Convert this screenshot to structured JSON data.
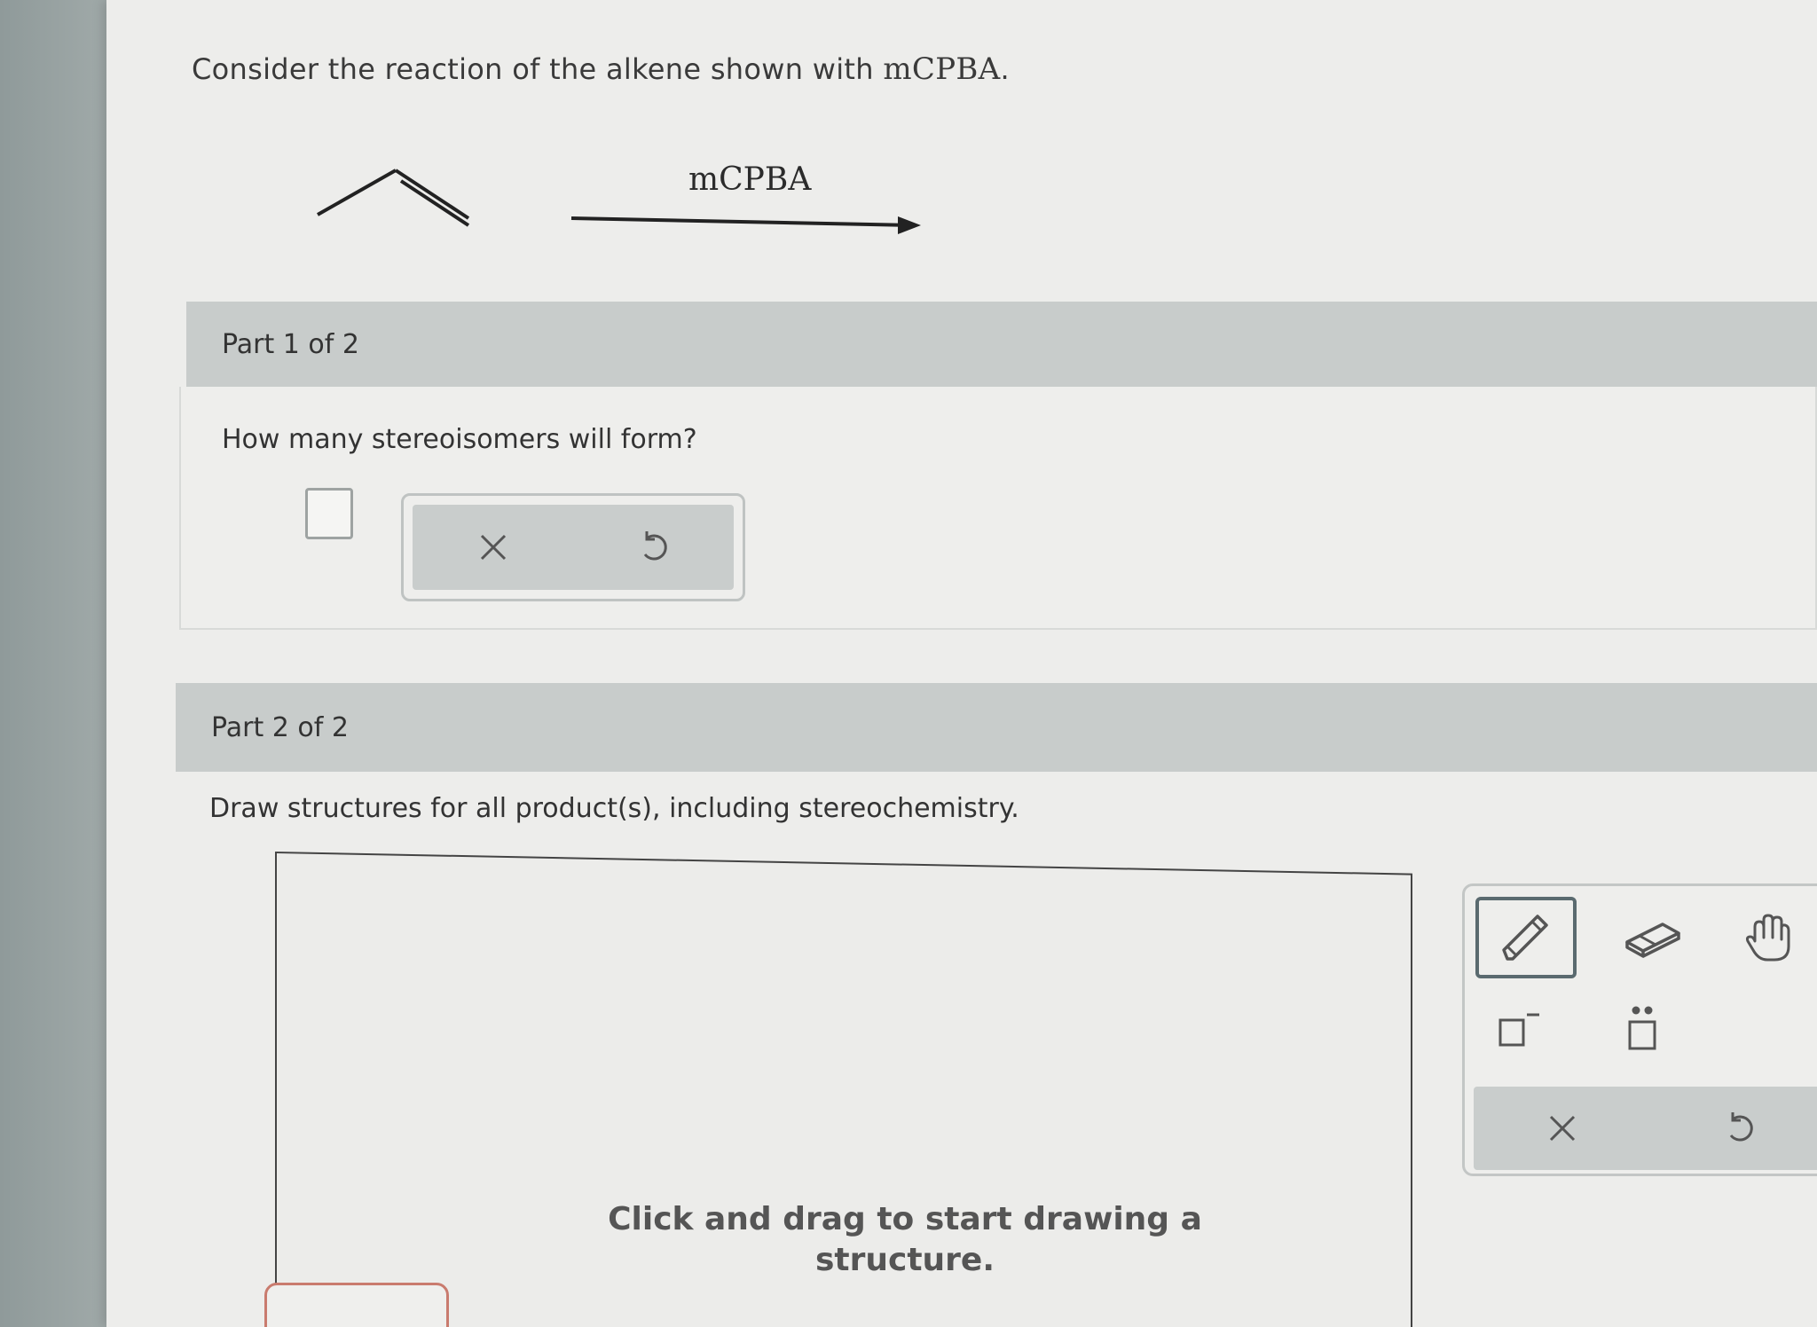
{
  "question": {
    "prefix": "Consider the reaction of the alkene shown with ",
    "reagent_inline": "mCPBA",
    "suffix": "."
  },
  "reaction": {
    "reagent_label": "mCPBA",
    "reactant": "propene (skeletal structure)"
  },
  "part1": {
    "header": "Part 1 of 2",
    "prompt": "How many stereoisomers will form?",
    "answer_value": "",
    "clear_icon": "close-icon",
    "undo_icon": "undo-icon"
  },
  "part2": {
    "header": "Part 2 of 2",
    "prompt": "Draw structures for all product(s), including stereochemistry.",
    "canvas_hint_line1": "Click and drag to start drawing a",
    "canvas_hint_line2": "structure.",
    "tools": [
      "pencil-icon",
      "eraser-icon",
      "hand-icon",
      "charge-icon",
      "lone-pair-icon",
      "close-icon",
      "undo-icon"
    ]
  },
  "colors": {
    "header_bg": "#c8cccb",
    "page_bg": "#ededeb",
    "active_tool_border": "#5a6a6f",
    "bottom_tab_border": "#c97b6e"
  }
}
